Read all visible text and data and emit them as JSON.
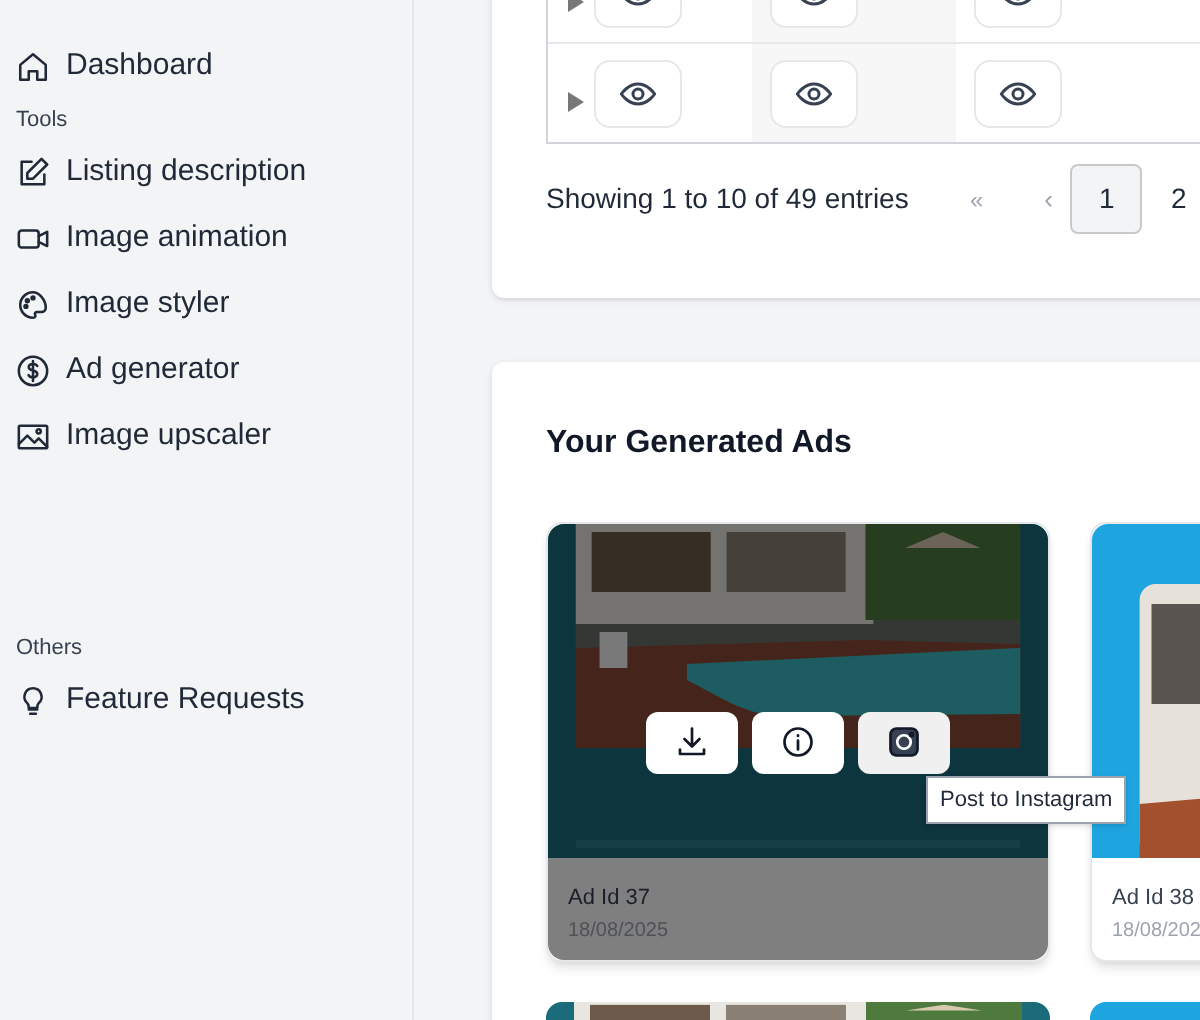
{
  "sidebar": {
    "items": [
      {
        "kind": "link",
        "label": "Dashboard"
      },
      {
        "kind": "heading",
        "label": "Tools"
      },
      {
        "kind": "link",
        "label": "Listing description"
      },
      {
        "kind": "link",
        "label": "Image animation"
      },
      {
        "kind": "link",
        "label": "Image styler"
      },
      {
        "kind": "link",
        "label": "Ad generator"
      },
      {
        "kind": "link",
        "label": "Image upscaler"
      },
      {
        "kind": "spacer"
      },
      {
        "kind": "heading",
        "label": "Others"
      },
      {
        "kind": "link",
        "label": "Feature Requests"
      }
    ]
  },
  "table": {
    "rows": [
      {
        "expanded": false,
        "cells": [
          {
            "kind": "view"
          },
          {
            "kind": "view"
          },
          {
            "kind": "view"
          }
        ]
      },
      {
        "expanded": false,
        "cells": [
          {
            "kind": "view"
          },
          {
            "kind": "view"
          },
          {
            "kind": "view"
          }
        ]
      }
    ],
    "summary": "Showing 1 to 10 of 49 entries",
    "first": "«",
    "prev": "‹",
    "pages": [
      {
        "label": "1",
        "selected": true
      },
      {
        "label": "2",
        "selected": false
      }
    ]
  },
  "generated_ads": {
    "title": "Your Generated Ads",
    "ads": [
      {
        "id": "Ad Id 37",
        "date": "18/08/2025",
        "hovered": true,
        "tooltip": "Post to Instagram",
        "actions": [
          {
            "kind": "download",
            "hovered": false
          },
          {
            "kind": "info",
            "hovered": false
          },
          {
            "kind": "instagram",
            "hovered": true
          }
        ]
      },
      {
        "id": "Ad Id 38",
        "date": "18/08/202",
        "hovered": false
      }
    ]
  }
}
